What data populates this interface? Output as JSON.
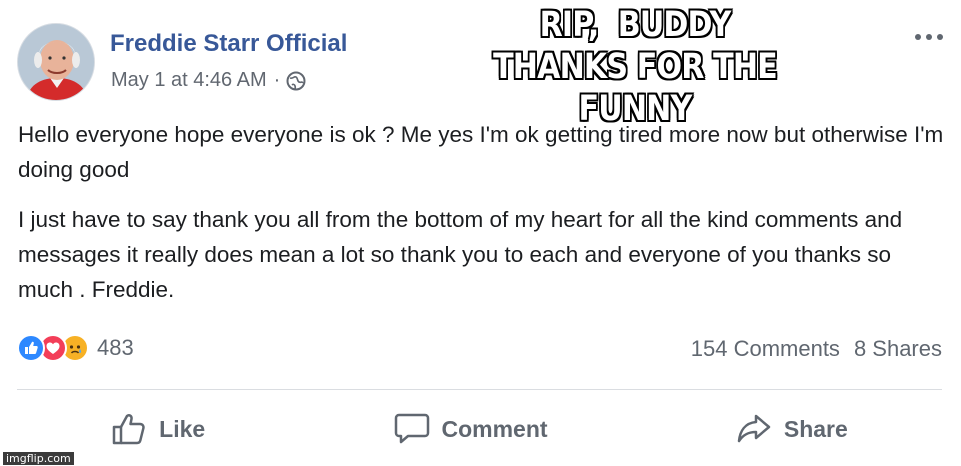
{
  "post": {
    "author": "Freddie Starr Official",
    "timestamp": "May 1 at 4:46 AM",
    "separator": "·",
    "privacy_icon": "globe-icon",
    "menu_icon": "more-options-icon",
    "paragraphs": [
      "Hello everyone hope everyone is ok ? Me yes I'm ok getting tired more now but otherwise I'm doing good",
      "I just have to say thank you all from the bottom of my heart for all the kind comments and messages it really does mean a lot so thank you to each and everyone of you thanks so much . Freddie."
    ]
  },
  "meme_caption": {
    "line1": "RIP,  BUDDY",
    "line2": "THANKS FOR THE FUNNY"
  },
  "reactions": {
    "icons": [
      "like-reaction-icon",
      "love-reaction-icon",
      "sad-reaction-icon"
    ],
    "count": "483",
    "comments": "154 Comments",
    "shares": "8 Shares"
  },
  "actions": {
    "like": "Like",
    "comment": "Comment",
    "share": "Share"
  },
  "colors": {
    "author_link": "#385898",
    "like_blue": "#2d88ff",
    "love_red": "#f33e58",
    "sad_yellow": "#f7b125",
    "muted_text": "#606770"
  },
  "watermark": "imgflip.com"
}
